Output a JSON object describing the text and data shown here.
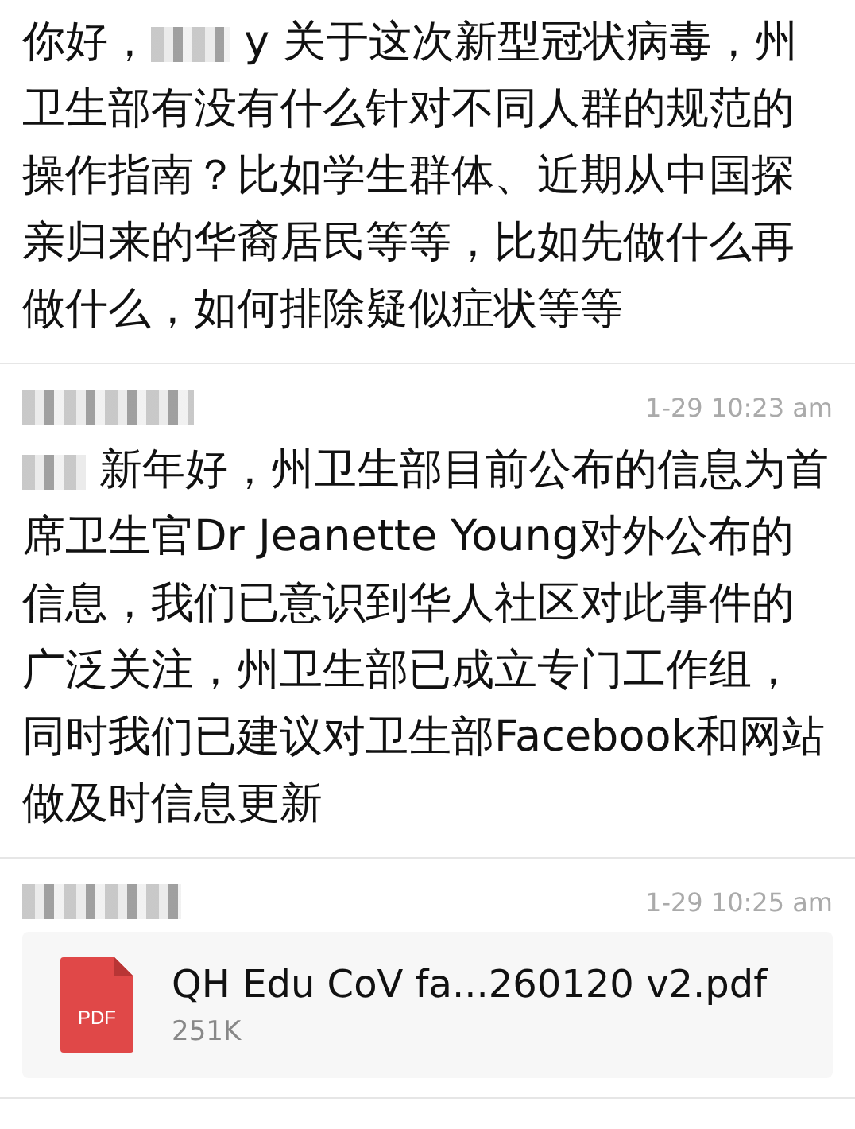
{
  "messages": [
    {
      "sender_redacted": false,
      "lead": "你好，",
      "body": "y 关于这次新型冠状病毒，州卫生部有没有什么针对不同人群的规范的操作指南？比如学生群体、近期从中国探亲归来的华裔居民等等，比如先做什么再做什么，如何排除疑似症状等等"
    },
    {
      "sender_redacted": true,
      "time": "1-29 10:23 am",
      "body": "新年好，州卫生部目前公布的信息为首席卫生官Dr Jeanette Young对外公布的信息，我们已意识到华人社区对此事件的广泛关注，州卫生部已成立专门工作组，同时我们已建议对卫生部Facebook和网站做及时信息更新"
    },
    {
      "sender_redacted": true,
      "time": "1-29 10:25 am",
      "attachment": {
        "icon_label": "PDF",
        "name": "QH Edu CoV fa...260120 v2.pdf",
        "size": "251K"
      }
    }
  ]
}
